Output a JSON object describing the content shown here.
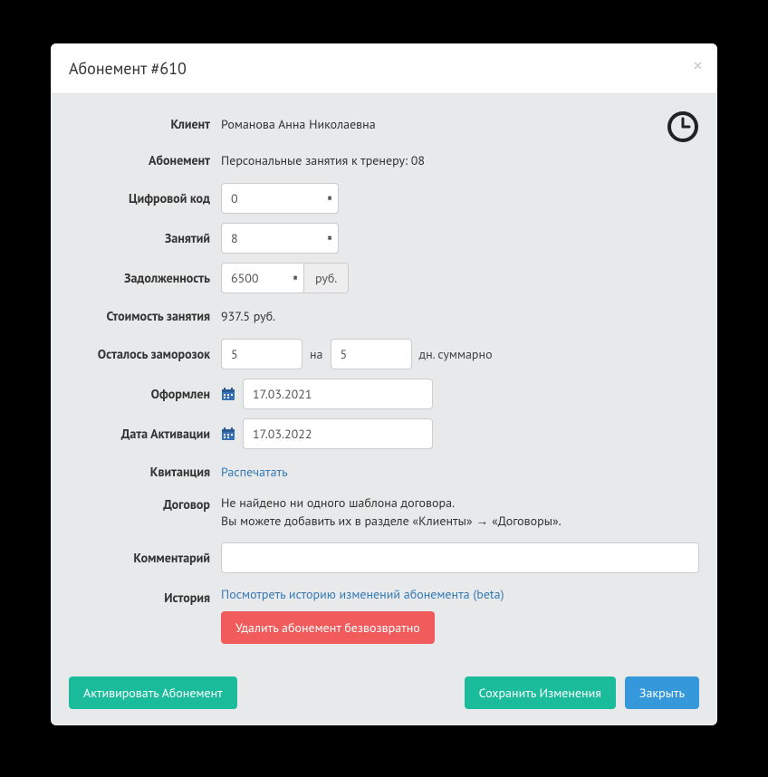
{
  "modal": {
    "title": "Абонемент #610"
  },
  "labels": {
    "client": "Клиент",
    "subscription": "Абонемент",
    "digital_code": "Цифровой код",
    "sessions": "Занятий",
    "debt": "Задолженность",
    "session_cost": "Стоимость занятия",
    "freezes_left": "Осталось заморозок",
    "issued": "Оформлен",
    "activation_date": "Дата Активации",
    "receipt": "Квитанция",
    "contract": "Договор",
    "comment": "Комментарий",
    "history": "История"
  },
  "values": {
    "client": "Романова Анна Николаевна",
    "subscription": "Персональные занятия к тренеру: 08",
    "digital_code": "0",
    "sessions": "8",
    "debt": "6500",
    "debt_unit": "руб.",
    "session_cost": "937.5 руб.",
    "freezes_count": "5",
    "freezes_on": "на",
    "freezes_days": "5",
    "freezes_unit": "дн. суммарно",
    "issued": "17.03.2021",
    "activation_date": "17.03.2022",
    "receipt_link": "Распечатать",
    "contract_line1": "Не найдено ни одного шаблона договора.",
    "contract_line2": "Вы можете добавить их в разделе «Клиенты» → «Договоры».",
    "comment": "",
    "history_link": "Посмотреть историю изменений абонемента (beta)",
    "delete_btn": "Удалить абонемент безвозвратно"
  },
  "footer": {
    "activate": "Активировать Абонемент",
    "save": "Сохранить Изменения",
    "close": "Закрыть"
  }
}
